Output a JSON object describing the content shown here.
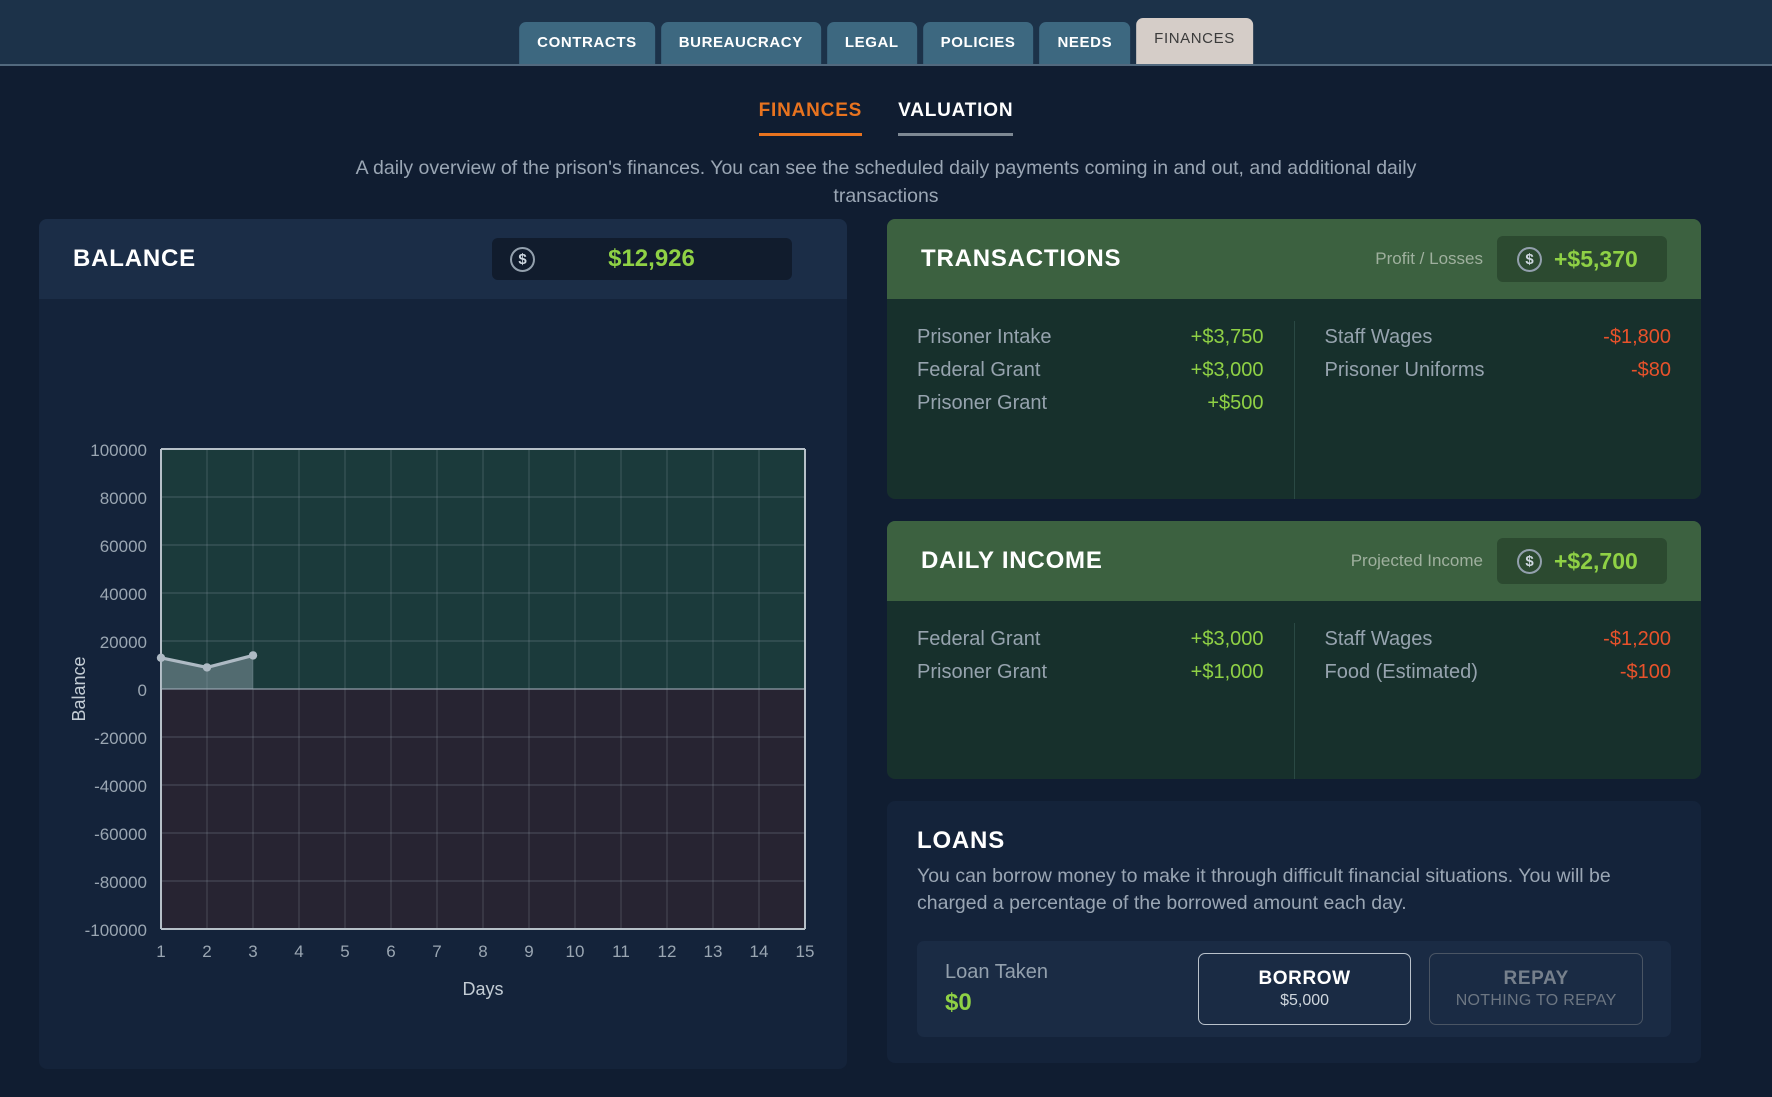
{
  "topbar": {
    "tabs": [
      {
        "label": "CONTRACTS",
        "active": false
      },
      {
        "label": "BUREAUCRACY",
        "active": false
      },
      {
        "label": "LEGAL",
        "active": false
      },
      {
        "label": "POLICIES",
        "active": false
      },
      {
        "label": "NEEDS",
        "active": false
      },
      {
        "label": "FINANCES",
        "active": true
      }
    ]
  },
  "subtabs": [
    {
      "label": "FINANCES",
      "active": true
    },
    {
      "label": "VALUATION",
      "active": false
    }
  ],
  "page_description": "A daily overview of the prison's finances. You can see the scheduled daily payments coming in and out, and additional daily transactions",
  "balance": {
    "title": "BALANCE",
    "coin_icon": "$",
    "amount": "$12,926"
  },
  "chart_data": {
    "type": "line",
    "title": "",
    "xlabel": "Days",
    "ylabel": "Balance",
    "x": [
      1,
      2,
      3,
      4,
      5,
      6,
      7,
      8,
      9,
      10,
      11,
      12,
      13,
      14,
      15
    ],
    "xtick_labels": [
      "1",
      "2",
      "3",
      "4",
      "5",
      "6",
      "7",
      "8",
      "9",
      "10",
      "11",
      "12",
      "13",
      "14",
      "15"
    ],
    "ytick_labels": [
      "100000",
      "80000",
      "60000",
      "40000",
      "20000",
      "0",
      "-20000",
      "-40000",
      "-60000",
      "-80000",
      "-100000"
    ],
    "yticks": [
      100000,
      80000,
      60000,
      40000,
      20000,
      0,
      -20000,
      -40000,
      -60000,
      -80000,
      -100000
    ],
    "xlim": [
      1,
      15
    ],
    "ylim": [
      -100000,
      100000
    ],
    "grid": true,
    "legend": "none",
    "series": [
      {
        "name": "Balance",
        "values": [
          13000,
          9000,
          14000,
          null,
          null,
          null,
          null,
          null,
          null,
          null,
          null,
          null,
          null,
          null,
          null
        ]
      }
    ]
  },
  "transactions": {
    "title": "TRANSACTIONS",
    "summary_label": "Profit / Losses",
    "coin_icon": "$",
    "summary_value": "+$5,370",
    "income": [
      {
        "label": "Prisoner Intake",
        "value": "+$3,750"
      },
      {
        "label": "Federal Grant",
        "value": "+$3,000"
      },
      {
        "label": "Prisoner Grant",
        "value": "+$500"
      }
    ],
    "expenses": [
      {
        "label": "Staff Wages",
        "value": "-$1,800"
      },
      {
        "label": "Prisoner Uniforms",
        "value": "-$80"
      }
    ]
  },
  "daily_income": {
    "title": "DAILY INCOME",
    "summary_label": "Projected Income",
    "coin_icon": "$",
    "summary_value": "+$2,700",
    "income": [
      {
        "label": "Federal Grant",
        "value": "+$3,000"
      },
      {
        "label": "Prisoner Grant",
        "value": "+$1,000"
      }
    ],
    "expenses": [
      {
        "label": "Staff Wages",
        "value": "-$1,200"
      },
      {
        "label": "Food (Estimated)",
        "value": "-$100"
      }
    ]
  },
  "loans": {
    "title": "LOANS",
    "description": "You can borrow money to make it through difficult financial situations. You will be charged a percentage of the borrowed amount each day.",
    "loan_taken_label": "Loan Taken",
    "loan_taken_value": "$0",
    "borrow_label": "BORROW",
    "borrow_amount": "$5,000",
    "repay_label": "REPAY",
    "repay_sublabel": "NOTHING TO REPAY"
  },
  "colors": {
    "positive": "#8fd145",
    "negative": "#e8522b",
    "accent": "#e8731f",
    "green_panel": "#3c6140"
  }
}
